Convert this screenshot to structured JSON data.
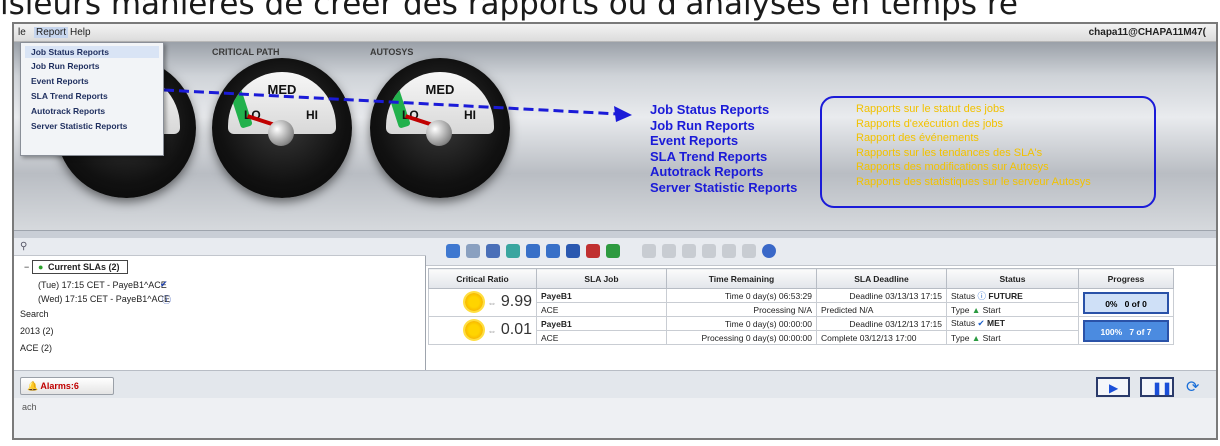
{
  "caption": "isieurs manières de créer des rapports ou d'analyses en temps ré",
  "menubar": {
    "file_label": "le",
    "report_label": "Report",
    "help_label": "Help",
    "user": "chapa11@CHAPA11M47("
  },
  "gauges": {
    "critical_label": "CRITICAL PATH",
    "autosys_label": "AUTOSYS",
    "med": "MED",
    "lo": "LO",
    "hi": "HI"
  },
  "report_menu": [
    "Job Status Reports",
    "Job Run Reports",
    "Event Reports",
    "SLA Trend Reports",
    "Autotrack Reports",
    "Server Statistic Reports"
  ],
  "annotations": {
    "en": [
      "Job Status Reports",
      "Job Run Reports",
      "Event Reports",
      "SLA Trend Reports",
      "Autotrack Reports",
      "Server Statistic Reports"
    ],
    "fr": [
      "Rapports sur le statut des jobs",
      "Rapports d'exécution des jobs",
      "Rapport des événements",
      "Rapports sur les tendances des SLA's",
      "Rapports des modifications sur Autosys",
      "Rapports des statistiques sur le serveur Autosys"
    ],
    "colors": {
      "en": "#1b1bd8",
      "fr": "#f2c200"
    }
  },
  "tree": {
    "current": "Current SLAs (2)",
    "item1": "(Tue) 17:15 CET - PayeB1^ACE",
    "item2": "(Wed) 17:15 CET - PayeB1^ACE",
    "search": "Search",
    "year": "2013 (2)",
    "ace": "ACE (2)"
  },
  "table": {
    "headers": [
      "Critical Ratio",
      "SLA Job",
      "Time Remaining",
      "SLA Deadline",
      "Status",
      "Progress"
    ],
    "rows": [
      {
        "ratio": "9.99",
        "job": "PayeB1",
        "group": "ACE",
        "time1": "Time  0 day(s) 06:53:29",
        "time2": "Processing  N/A",
        "dl1": "Deadline  03/13/13 17:15",
        "dl2": "Predicted  N/A",
        "st1_label": "Status",
        "st1": "FUTURE",
        "st2_label": "Type",
        "st2": "Start",
        "pct": "0%",
        "count": "0 of 0",
        "fill": 0.0
      },
      {
        "ratio": "0.01",
        "job": "PayeB1",
        "group": "ACE",
        "time1": "Time  0 day(s) 00:00:00",
        "time2": "Processing  0 day(s) 00:00:00",
        "dl1": "Deadline  03/12/13 17:15",
        "dl2": "Complete  03/12/13 17:00",
        "st1_label": "Status",
        "st1": "MET",
        "st2_label": "Type",
        "st2": "Start",
        "pct": "100%",
        "count": "7 of 7",
        "fill": 1.0
      }
    ]
  },
  "bottom": {
    "alarms": "Alarms:6"
  },
  "status_text": "ach"
}
